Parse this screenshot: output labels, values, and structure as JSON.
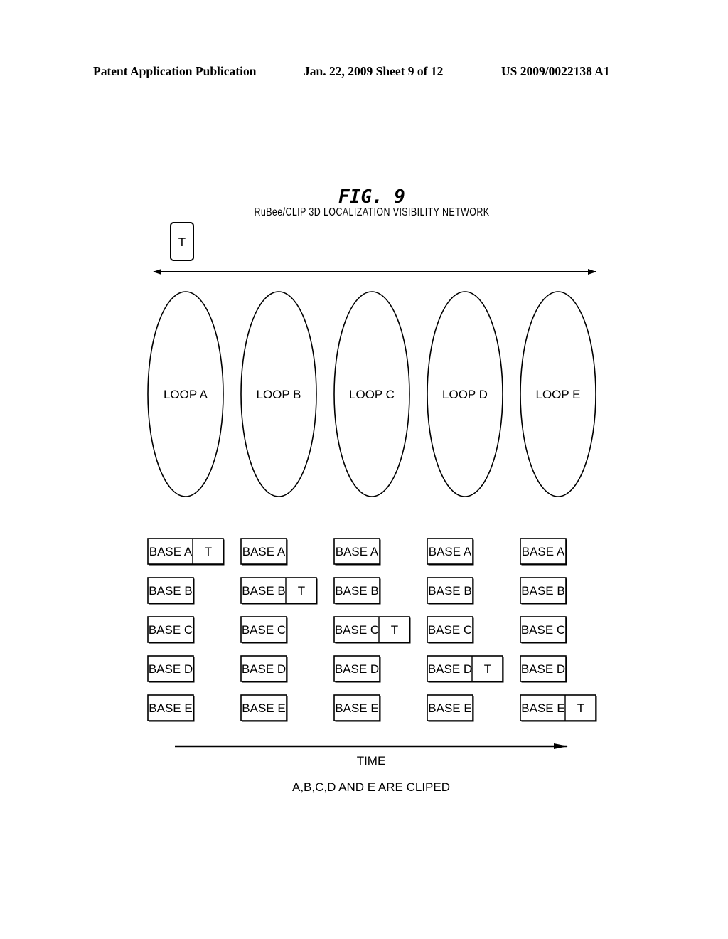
{
  "header": {
    "left": "Patent Application Publication",
    "center": "Jan. 22, 2009  Sheet 9 of 12",
    "right": "US 2009/0022138 A1"
  },
  "figure": {
    "title": "FIG. 9",
    "subtitle": "RuBee/CLIP 3D LOCALIZATION VISIBILITY NETWORK",
    "tag_label": "T",
    "loops": [
      "LOOP A",
      "LOOP B",
      "LOOP C",
      "LOOP D",
      "LOOP E"
    ],
    "columns": [
      {
        "bases": [
          "BASE A",
          "BASE B",
          "BASE C",
          "BASE D",
          "BASE E"
        ],
        "tag_at": 0
      },
      {
        "bases": [
          "BASE A",
          "BASE B",
          "BASE C",
          "BASE D",
          "BASE E"
        ],
        "tag_at": 1
      },
      {
        "bases": [
          "BASE A",
          "BASE B",
          "BASE C",
          "BASE D",
          "BASE E"
        ],
        "tag_at": 2
      },
      {
        "bases": [
          "BASE A",
          "BASE B",
          "BASE C",
          "BASE D",
          "BASE E"
        ],
        "tag_at": 3
      },
      {
        "bases": [
          "BASE A",
          "BASE B",
          "BASE C",
          "BASE D",
          "BASE E"
        ],
        "tag_at": 4
      }
    ],
    "time_label": "TIME",
    "caption": "A,B,C,D AND E ARE CLIPED"
  }
}
